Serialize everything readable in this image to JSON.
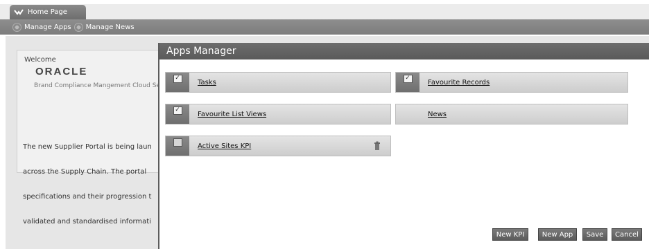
{
  "home_tab": {
    "label": "Home Page",
    "icon": "home-icon"
  },
  "nav": {
    "items": [
      {
        "label": "Manage Apps",
        "icon": "apps-icon"
      },
      {
        "label": "Manage News",
        "icon": "news-icon"
      }
    ]
  },
  "welcome": {
    "title": "Welcome",
    "logo_text": "ORACLE",
    "brand": "Brand Compliance Mangement Cloud Serv",
    "body_lines": [
      "The new Supplier Portal is being laun",
      "across the Supply Chain. The portal",
      "specifications and their progression t",
      "validated and standardised informati"
    ]
  },
  "apps_manager": {
    "title": "Apps Manager",
    "apps": [
      {
        "label": "Tasks",
        "checked": true
      },
      {
        "label": "Favourite Records",
        "checked": true
      },
      {
        "label": "Favourite List Views",
        "checked": true
      },
      {
        "label": "News",
        "checked": false
      },
      {
        "label": "Active Sites KPI",
        "checked": false
      }
    ],
    "buttons": {
      "new_kpi": "New KPI",
      "new_app": "New App",
      "save": "Save",
      "cancel": "Cancel"
    }
  },
  "colors": {
    "modal_header": "#5f5f5f",
    "nav_bar": "#858585",
    "tile": "#d8d8d8"
  }
}
